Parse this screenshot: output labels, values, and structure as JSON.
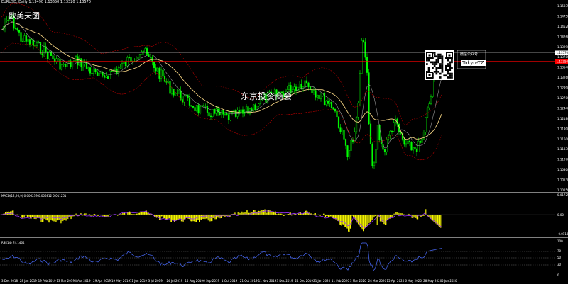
{
  "window": {
    "title": "EURUSD, Daily 1.13490 1.13650 1.13320 1.13570"
  },
  "overlay": {
    "title": "欧美天图",
    "center_text": "东京投资商会",
    "qr_caption": "微信公众号",
    "qr_handle": "Tokyo-TZ"
  },
  "colors": {
    "background": "#000000",
    "bull_candle": "#00ff00",
    "bear_candle": "#00ff00",
    "bollinger": "#c00000",
    "ma_slow": "#f0d080",
    "ma_fast": "#9a9a9a",
    "price_level": "#ff0000",
    "macd_hist": "#ffff00",
    "macd_signal": "#9b30ff",
    "rsi_line": "#4a6cff"
  },
  "price_axis": {
    "labels": [
      "1.15035",
      "1.14750",
      "1.14520",
      "1.14260",
      "1.13990",
      "1.13780",
      "1.13540",
      "1.13260",
      "1.12990",
      "1.12700",
      "1.12440",
      "1.12180",
      "1.11900",
      "1.11600",
      "1.11330",
      "1.11070",
      "1.10800",
      "1.10530",
      "1.10250"
    ],
    "current_price": "1.13570",
    "level_price": "1.13350"
  },
  "macd": {
    "label": "MACD(12,26,9) 0.006239 0.006812 0.011251",
    "axis_labels": [
      "0.017256",
      "0.00",
      "-0.011397"
    ]
  },
  "rsi": {
    "label": "RSI(14) 74.1464",
    "axis_labels": [
      "100",
      "70",
      "50",
      "30",
      "0"
    ]
  },
  "time_axis": {
    "labels": [
      "3 Dec 2018",
      "28 Jan 2019",
      "19 Feb 2019",
      "13 Mar 2019",
      "4 Apr 2019",
      "29 Apr 2019",
      "19 May 2019",
      "11 Jun 2019",
      "3 Jul 2019",
      "24 Jul 2019",
      "15 Aug 2019",
      "6 Sep 2019",
      "1 Oct 2019",
      "21 Oct 2019",
      "11 Nov 2019",
      "3 Dec 2019",
      "24 Dec 2019",
      "21 Jan 2020",
      "11 Feb 2020",
      "3 Mar 2020",
      "24 Mar 2020",
      "15 Apr 2020",
      "6 May 2020",
      "28 May 2020",
      "5 Jun 2020"
    ]
  }
}
